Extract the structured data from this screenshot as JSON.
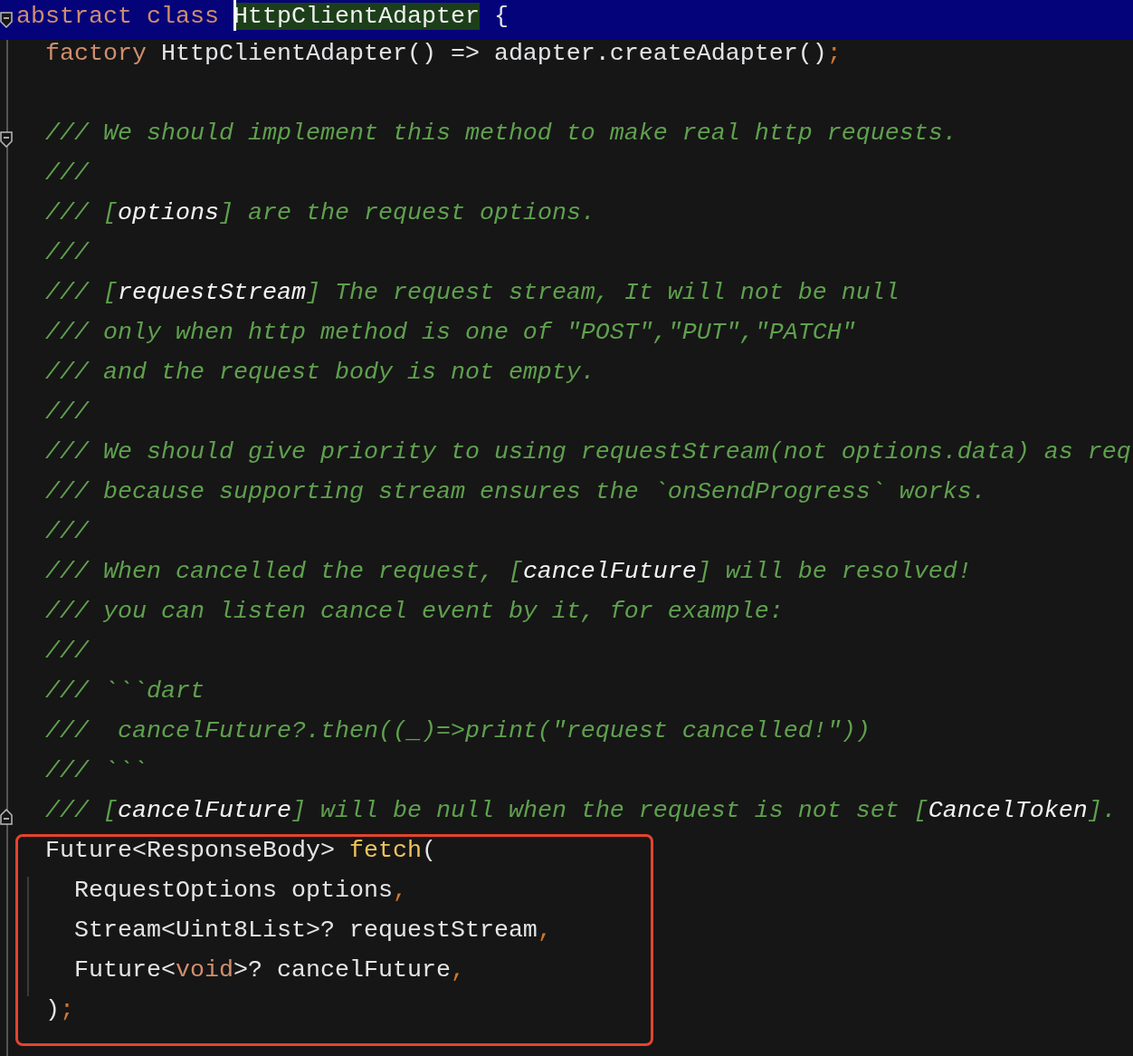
{
  "editor": {
    "lines": [
      {
        "kind": "current",
        "fold_start": true,
        "tokens": [
          {
            "kind": "keyword",
            "text": "abstract class "
          },
          {
            "kind": "match",
            "caret": true,
            "text": "HttpClientAdapter"
          },
          {
            "kind": "plain",
            "text": " {"
          }
        ]
      },
      {
        "kind": "code",
        "tokens": [
          {
            "kind": "keyword",
            "text": "  factory"
          },
          {
            "kind": "plain",
            "text": " HttpClientAdapter() => adapter.createAdapter()"
          },
          {
            "kind": "punct",
            "text": ";"
          }
        ]
      },
      {
        "kind": "blank"
      },
      {
        "kind": "code",
        "fold_start": true,
        "tokens": [
          {
            "kind": "comment",
            "text": "  /// We should implement this method to make real http requests."
          }
        ]
      },
      {
        "kind": "code",
        "tokens": [
          {
            "kind": "comment",
            "text": "  ///"
          }
        ]
      },
      {
        "kind": "code",
        "tokens": [
          {
            "kind": "comment",
            "text": "  /// ["
          },
          {
            "kind": "ref",
            "text": "options"
          },
          {
            "kind": "comment",
            "text": "] are the request options."
          }
        ]
      },
      {
        "kind": "code",
        "tokens": [
          {
            "kind": "comment",
            "text": "  ///"
          }
        ]
      },
      {
        "kind": "code",
        "tokens": [
          {
            "kind": "comment",
            "text": "  /// ["
          },
          {
            "kind": "ref",
            "text": "requestStream"
          },
          {
            "kind": "comment",
            "text": "] The request stream, It will not be null"
          }
        ]
      },
      {
        "kind": "code",
        "tokens": [
          {
            "kind": "comment",
            "text": "  /// only when http method is one of \"POST\",\"PUT\",\"PATCH\""
          }
        ]
      },
      {
        "kind": "code",
        "tokens": [
          {
            "kind": "comment",
            "text": "  /// and the request body is not empty."
          }
        ]
      },
      {
        "kind": "code",
        "tokens": [
          {
            "kind": "comment",
            "text": "  ///"
          }
        ]
      },
      {
        "kind": "code",
        "tokens": [
          {
            "kind": "comment",
            "text": "  /// We should give priority to using requestStream(not options.data) as req"
          }
        ]
      },
      {
        "kind": "code",
        "tokens": [
          {
            "kind": "comment",
            "text": "  /// because supporting stream ensures the `onSendProgress` works."
          }
        ]
      },
      {
        "kind": "code",
        "tokens": [
          {
            "kind": "comment",
            "text": "  ///"
          }
        ]
      },
      {
        "kind": "code",
        "tokens": [
          {
            "kind": "comment",
            "text": "  /// When cancelled the request, ["
          },
          {
            "kind": "ref",
            "text": "cancelFuture"
          },
          {
            "kind": "comment",
            "text": "] will be resolved!"
          }
        ]
      },
      {
        "kind": "code",
        "tokens": [
          {
            "kind": "comment",
            "text": "  /// you can listen cancel event by it, for example:"
          }
        ]
      },
      {
        "kind": "code",
        "tokens": [
          {
            "kind": "comment",
            "text": "  ///"
          }
        ]
      },
      {
        "kind": "code",
        "tokens": [
          {
            "kind": "comment",
            "text": "  /// ```dart"
          }
        ]
      },
      {
        "kind": "code",
        "tokens": [
          {
            "kind": "comment",
            "text": "  ///  cancelFuture?.then((_)=>print(\"request cancelled!\"))"
          }
        ]
      },
      {
        "kind": "code",
        "tokens": [
          {
            "kind": "comment",
            "text": "  /// ```"
          }
        ]
      },
      {
        "kind": "code",
        "fold_end": true,
        "tokens": [
          {
            "kind": "comment",
            "text": "  /// ["
          },
          {
            "kind": "ref",
            "text": "cancelFuture"
          },
          {
            "kind": "comment",
            "text": "] will be null when the request is not set ["
          },
          {
            "kind": "ref",
            "text": "CancelToken"
          },
          {
            "kind": "comment",
            "text": "]."
          }
        ]
      }
    ],
    "framed_block": {
      "lines": [
        {
          "tokens": [
            {
              "kind": "plain",
              "text": "  Future<ResponseBody> "
            },
            {
              "kind": "function",
              "text": "fetch"
            },
            {
              "kind": "plain",
              "text": "("
            }
          ]
        },
        {
          "tokens": [
            {
              "kind": "plain",
              "text": "    RequestOptions options"
            },
            {
              "kind": "punct",
              "text": ","
            }
          ]
        },
        {
          "tokens": [
            {
              "kind": "plain",
              "text": "    Stream<Uint8List>? requestStream"
            },
            {
              "kind": "punct",
              "text": ","
            }
          ]
        },
        {
          "tokens": [
            {
              "kind": "plain",
              "text": "    Future<"
            },
            {
              "kind": "keyword",
              "text": "void"
            },
            {
              "kind": "plain",
              "text": ">? cancelFuture"
            },
            {
              "kind": "punct",
              "text": ","
            }
          ]
        },
        {
          "tokens": [
            {
              "kind": "plain",
              "text": "  )"
            },
            {
              "kind": "punct",
              "text": ";"
            }
          ]
        }
      ]
    }
  }
}
